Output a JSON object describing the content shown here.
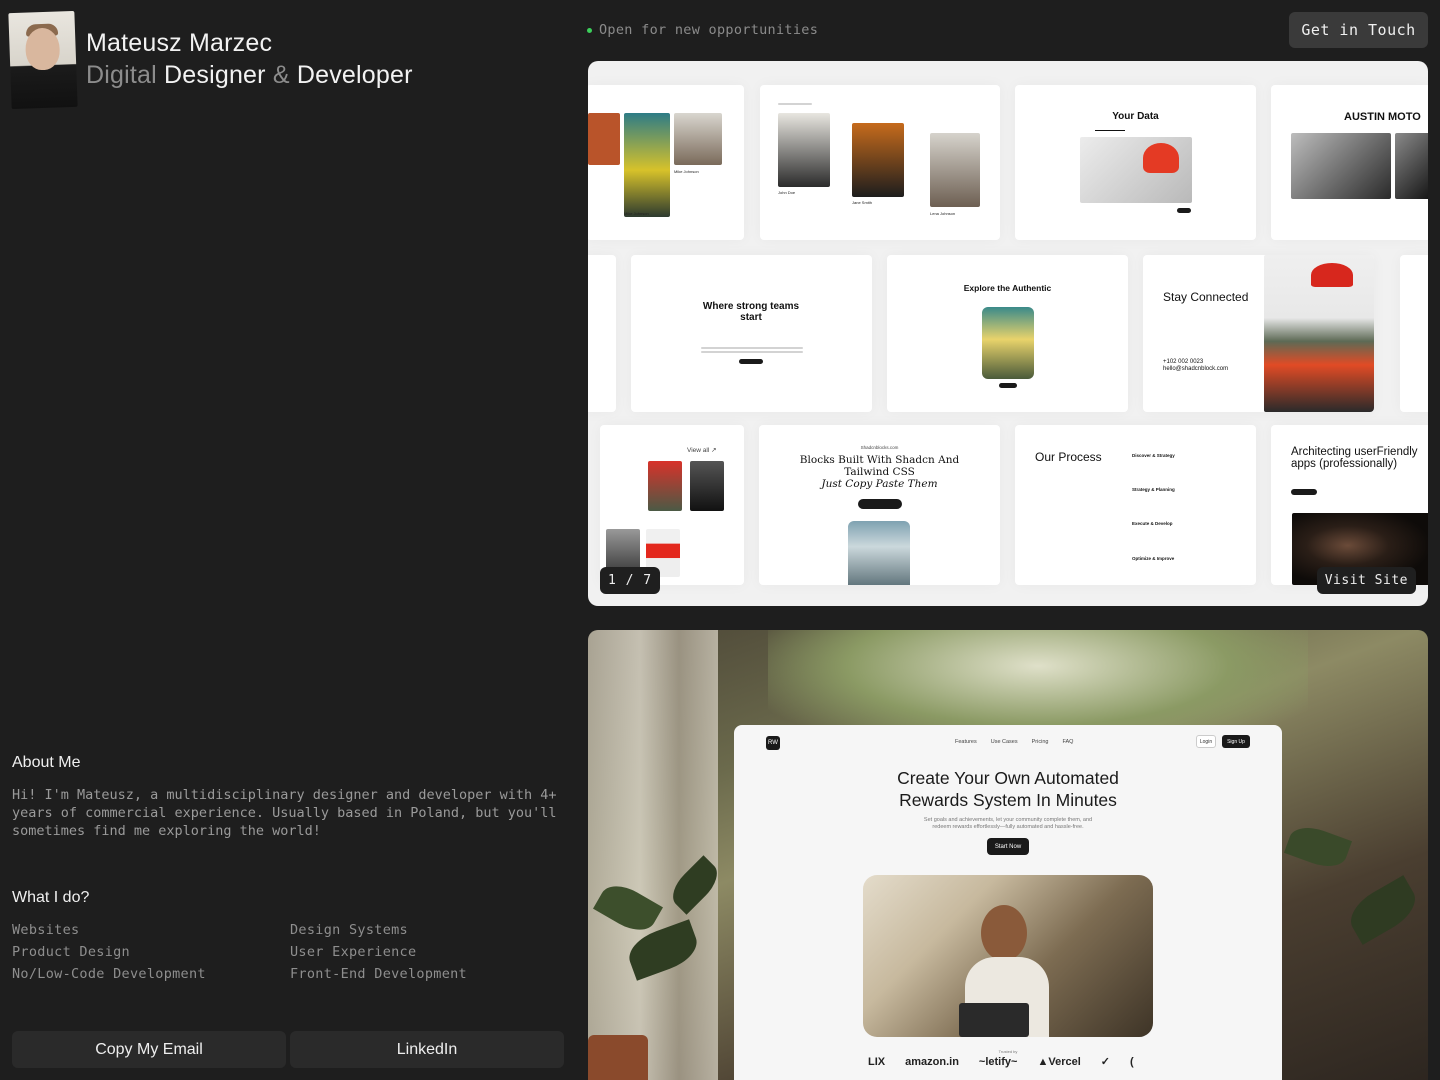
{
  "profile": {
    "name": "Mateusz Marzec",
    "role_part1": "Digital",
    "role_part2": "Designer",
    "role_part3": "&",
    "role_part4": "Developer"
  },
  "status": {
    "text": "Open for new opportunities",
    "dot_color": "#3ccf5b"
  },
  "header": {
    "contact_label": "Get in Touch"
  },
  "about": {
    "title": "About Me",
    "text": "Hi! I'm Mateusz, a multidisciplinary designer and developer with 4+ years of commercial experience. Usually based in Poland, but you'll sometimes find me exploring the world!"
  },
  "services": {
    "title": "What I do?",
    "items": [
      "Websites",
      "Design Systems",
      "Product Design",
      "User Experience",
      "No/Low-Code Development",
      "Front-End Development"
    ]
  },
  "actions": {
    "copy_email": "Copy My Email",
    "linkedin": "LinkedIn"
  },
  "project1": {
    "counter": "1 / 7",
    "visit_label": "Visit Site",
    "tiles": {
      "your_data": "Your Data",
      "austin": "AUSTIN MOTO",
      "strong_teams": "Where strong teams start",
      "explore": "Explore the Authentic",
      "stay_connected": "Stay Connected",
      "phone": "+102 002 0023",
      "email": "hello@shadcnblock.com",
      "view_all": "View all ↗",
      "blocks_source": "Shadcnblocks.com",
      "blocks_title": "Blocks Built With Shadcn And Tailwind CSS",
      "blocks_italic": "Just Copy Paste Them",
      "our_process": "Our Process",
      "process_steps": [
        "Discover & Strategy",
        "Strategy & Planning",
        "Execute & Develop",
        "Optimize & Improve"
      ],
      "architecting": "Architecting userFriendly apps (professionally)",
      "person_names": [
        "Mike Johnson",
        "John Doe",
        "Jane Smith",
        "Lena Johnson"
      ],
      "product_labels": [
        "E-commerce Platform",
        "Mobile Banking App"
      ]
    }
  },
  "project2": {
    "logo": "RW",
    "nav": [
      "Features",
      "Use Cases",
      "Pricing",
      "FAQ"
    ],
    "login": "Login",
    "signup": "Sign Up",
    "title_line1": "Create Your Own Automated",
    "title_line2": "Rewards System In Minutes",
    "subtitle_line1": "Set goals and achievements, let your community complete them, and",
    "subtitle_line2": "redeem rewards effortlessly—fully automated and hassle-free.",
    "cta": "Start Now",
    "trusted": "Trusted by",
    "logos": [
      "LIX",
      "amazon.in",
      "~letify~",
      "▲Vercel",
      "✓",
      "("
    ]
  }
}
